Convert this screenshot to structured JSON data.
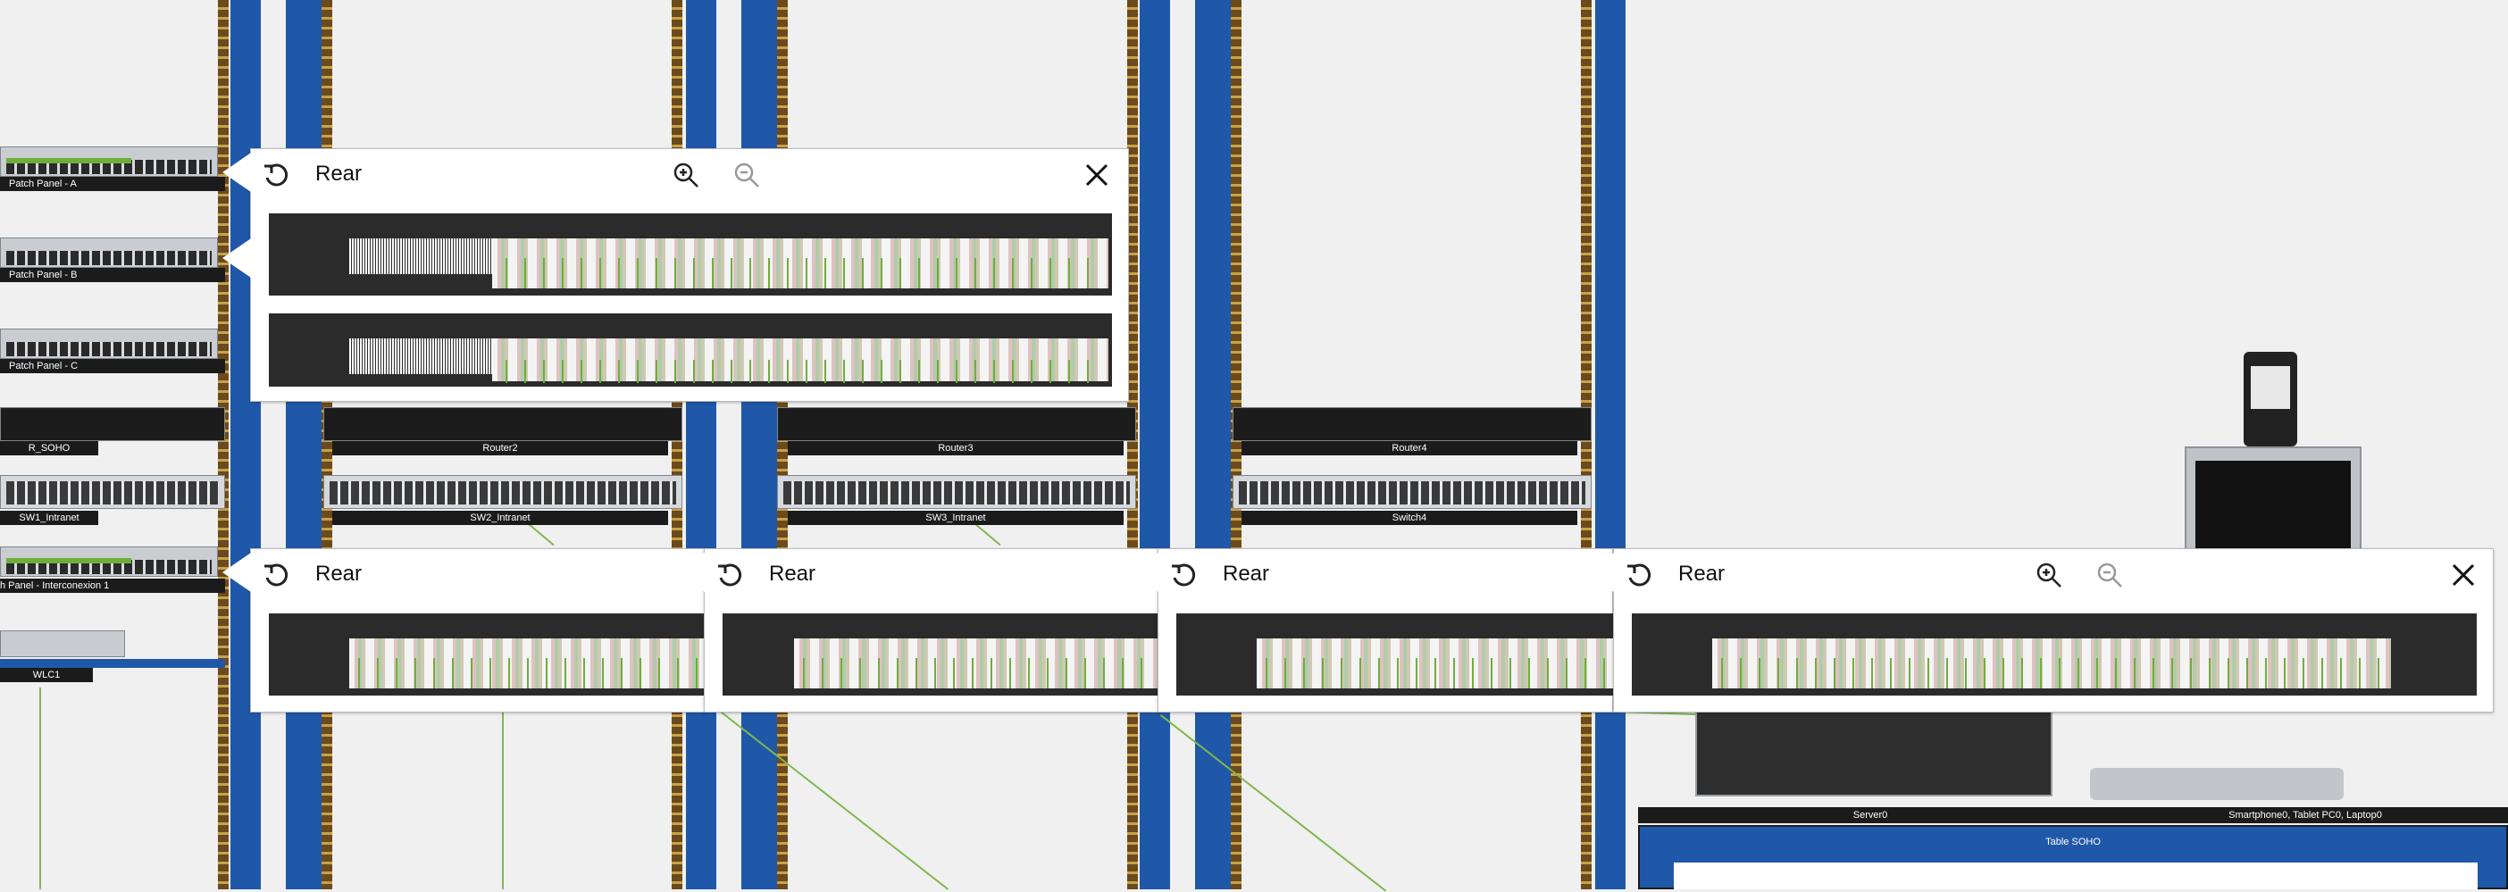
{
  "popup_title": "Rear",
  "popups_top": [
    {
      "title": "Rear"
    }
  ],
  "popups_bottom": [
    {
      "title": "Rear"
    },
    {
      "title": "Rear"
    },
    {
      "title": "Rear"
    },
    {
      "title": "Rear"
    }
  ],
  "devices": {
    "patch_a": "Patch Panel - A",
    "patch_b": "Patch Panel - B",
    "patch_c": "Patch Panel - C",
    "r_soho": "R_SOHO",
    "router2": "Router2",
    "router3": "Router3",
    "router4": "Router4",
    "sw1": "SW1_Intranet",
    "sw2": "SW2_Intranet",
    "sw3": "SW3_Intranet",
    "switch4": "Switch4",
    "patch_inter": "h Panel - Interconexion 1",
    "wlc1": "WLC1",
    "server0": "Server0",
    "end_devices": "Smartphone0, Tablet PC0, Laptop0",
    "table_soho": "Table SOHO"
  },
  "icons": {
    "rotate": "rotate-icon",
    "zoom_in": "zoom-in-icon",
    "zoom_out": "zoom-out-icon",
    "close": "close-icon"
  },
  "colors": {
    "rack_rail_blue": "#1f58a8",
    "rack_rail_brown": "#6b4a1e",
    "cable_green": "#7fb84e",
    "label_bg": "#1b1b1b"
  }
}
